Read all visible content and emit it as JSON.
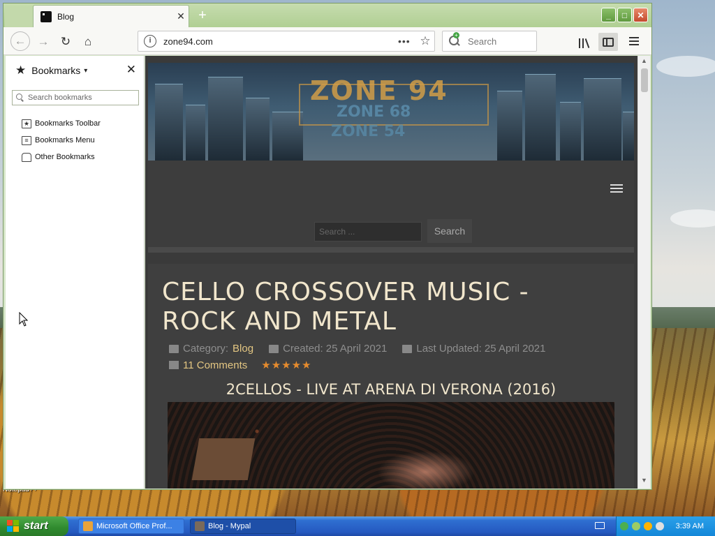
{
  "browser": {
    "tab": {
      "title": "Blog"
    },
    "url": "zone94.com",
    "search_placeholder": "Search"
  },
  "sidebar": {
    "title": "Bookmarks",
    "search_placeholder": "Search bookmarks",
    "items": [
      {
        "label": "Bookmarks Toolbar",
        "icon": "bookmarks-toolbar-icon"
      },
      {
        "label": "Bookmarks Menu",
        "icon": "bookmarks-menu-icon"
      },
      {
        "label": "Other Bookmarks",
        "icon": "other-bookmarks-icon"
      }
    ]
  },
  "page": {
    "banner": {
      "logo_main": "ZONE 94",
      "logo_sub1": "ZONE 68",
      "logo_sub2": "ZONE 54"
    },
    "search": {
      "placeholder": "Search ...",
      "button": "Search"
    },
    "article": {
      "title": "CELLO CROSSOVER MUSIC - ROCK AND METAL",
      "category_label": "Category:",
      "category": "Blog",
      "created": "Created: 25 April 2021",
      "updated": "Last Updated: 25 April 2021",
      "comments": "11 Comments",
      "rating": "★★★★★",
      "subheading": "2CELLOS - LIVE AT ARENA DI VERONA (2016)"
    }
  },
  "desktop": {
    "notepad_label": "Notepad++"
  },
  "taskbar": {
    "start": "start",
    "tasks": [
      {
        "label": "Microsoft Office Prof..."
      },
      {
        "label": "Blog - Mypal"
      }
    ],
    "clock": "3:39 AM"
  },
  "colors": {
    "accent_gold": "#e3c682",
    "title_cream": "#f1e6cc",
    "star_orange": "#e58b2e",
    "window_frame_green": "#b0cf93",
    "taskbar_blue": "#2559c0"
  }
}
